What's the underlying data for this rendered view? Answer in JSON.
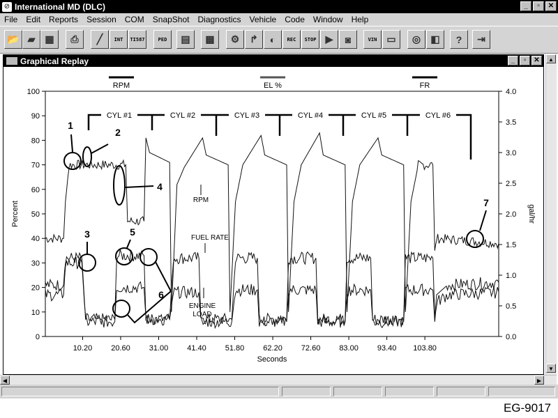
{
  "app": {
    "title": "International MD (DLC)",
    "window_buttons": [
      "_",
      "▫",
      "✕"
    ]
  },
  "menu": [
    "File",
    "Edit",
    "Reports",
    "Session",
    "COM",
    "SnapShot",
    "Diagnostics",
    "Vehicle",
    "Code",
    "Window",
    "Help"
  ],
  "toolbar": {
    "buttons": [
      {
        "name": "open-icon"
      },
      {
        "name": "save-icon"
      },
      {
        "name": "print-preview-icon"
      },
      {
        "name": "print-icon"
      },
      {
        "name": "graph-icon"
      },
      {
        "name": "int-icon",
        "text": "INT"
      },
      {
        "name": "ti587-icon",
        "text": "TI587"
      },
      {
        "name": "ped-icon",
        "text": "PED"
      },
      {
        "name": "data-icon"
      },
      {
        "name": "session-icon"
      },
      {
        "name": "engine-icon"
      },
      {
        "name": "injector-icon"
      },
      {
        "name": "gauge-icon"
      },
      {
        "name": "record-icon",
        "text": "REC"
      },
      {
        "name": "stop-icon",
        "text": "STOP"
      },
      {
        "name": "playback-icon"
      },
      {
        "name": "camera-icon"
      },
      {
        "name": "vin-icon",
        "text": "VIN"
      },
      {
        "name": "monitor-icon"
      },
      {
        "name": "sensor-icon"
      },
      {
        "name": "window-icon"
      },
      {
        "name": "help-icon",
        "text": "?"
      },
      {
        "name": "exit-icon"
      }
    ]
  },
  "child_window": {
    "title": "Graphical Replay"
  },
  "chart_data": {
    "type": "line",
    "legend": [
      "RPM",
      "EL %",
      "FR"
    ],
    "xlabel": "Seconds",
    "ylabel_left": "Percent",
    "ylabel_right": "gal/hr",
    "xlim": [
      0,
      124
    ],
    "ylim_left": [
      0,
      100
    ],
    "ylim_right": [
      0.0,
      4.0
    ],
    "x_ticks": [
      "10.20",
      "20.60",
      "31.00",
      "41.40",
      "51.80",
      "62.20",
      "72.60",
      "83.00",
      "93.40",
      "103.80"
    ],
    "x_tick_values": [
      10.2,
      20.6,
      31.0,
      41.4,
      51.8,
      62.2,
      72.6,
      83.0,
      93.4,
      103.8
    ],
    "y_ticks_left": [
      "0",
      "10",
      "20",
      "30",
      "40",
      "50",
      "60",
      "70",
      "80",
      "90",
      "100"
    ],
    "y_ticks_right": [
      "0.0",
      "0.5",
      "1.0",
      "1.5",
      "2.0",
      "2.5",
      "3.0",
      "3.5",
      "4.0"
    ],
    "series": [
      {
        "name": "RPM",
        "points": [
          [
            0,
            40
          ],
          [
            5,
            40
          ],
          [
            5.5,
            55
          ],
          [
            6.5,
            70
          ],
          [
            22,
            70
          ],
          [
            22.5,
            47
          ],
          [
            27,
            47
          ],
          [
            27.5,
            81
          ],
          [
            28.5,
            75
          ],
          [
            34,
            71
          ],
          [
            34.5,
            10
          ],
          [
            36,
            62
          ],
          [
            38,
            69
          ],
          [
            43,
            81
          ],
          [
            44,
            74
          ],
          [
            50,
            70
          ],
          [
            50.5,
            10
          ],
          [
            52,
            55
          ],
          [
            54,
            70
          ],
          [
            59,
            82
          ],
          [
            60,
            74
          ],
          [
            66,
            70
          ],
          [
            66.5,
            10
          ],
          [
            68,
            55
          ],
          [
            70,
            70
          ],
          [
            75,
            83
          ],
          [
            76,
            74
          ],
          [
            82,
            70
          ],
          [
            82.5,
            10
          ],
          [
            84,
            55
          ],
          [
            86,
            70
          ],
          [
            91,
            81
          ],
          [
            92,
            74
          ],
          [
            98,
            70
          ],
          [
            98.5,
            10
          ],
          [
            100,
            55
          ],
          [
            102,
            70
          ],
          [
            106,
            70
          ],
          [
            106.5,
            35
          ],
          [
            107,
            40
          ],
          [
            124,
            38
          ]
        ]
      },
      {
        "name": "FR",
        "points": [
          [
            0,
            21
          ],
          [
            5,
            21
          ],
          [
            5.5,
            32
          ],
          [
            10,
            32
          ],
          [
            11,
            7
          ],
          [
            19,
            7
          ],
          [
            19.5,
            33
          ],
          [
            27,
            33
          ],
          [
            27.5,
            7
          ],
          [
            34,
            7
          ],
          [
            35,
            32
          ],
          [
            42,
            32
          ],
          [
            42.5,
            7
          ],
          [
            51,
            7
          ],
          [
            52,
            32
          ],
          [
            58,
            32
          ],
          [
            58.5,
            7
          ],
          [
            66,
            7
          ],
          [
            66.5,
            32
          ],
          [
            74,
            32
          ],
          [
            74.5,
            7
          ],
          [
            82,
            7
          ],
          [
            82.5,
            32
          ],
          [
            89,
            32
          ],
          [
            89.5,
            7
          ],
          [
            98,
            7
          ],
          [
            98.5,
            32
          ],
          [
            106,
            32
          ],
          [
            106.5,
            7
          ],
          [
            107,
            17
          ],
          [
            110,
            21
          ],
          [
            124,
            22
          ]
        ]
      },
      {
        "name": "EL %",
        "points": [
          [
            0,
            17
          ],
          [
            5,
            17
          ],
          [
            5.5,
            30
          ],
          [
            10,
            30
          ],
          [
            11,
            6
          ],
          [
            19,
            6
          ],
          [
            19.5,
            20
          ],
          [
            27,
            20
          ],
          [
            27.5,
            7
          ],
          [
            34,
            7
          ],
          [
            35,
            18
          ],
          [
            42,
            18
          ],
          [
            42.5,
            6
          ],
          [
            51,
            6
          ],
          [
            52,
            19
          ],
          [
            58,
            19
          ],
          [
            58.5,
            6
          ],
          [
            66,
            6
          ],
          [
            66.5,
            19
          ],
          [
            74,
            19
          ],
          [
            74.5,
            6
          ],
          [
            82,
            6
          ],
          [
            82.5,
            19
          ],
          [
            89,
            19
          ],
          [
            89.5,
            6
          ],
          [
            98,
            6
          ],
          [
            98.5,
            19
          ],
          [
            106,
            19
          ],
          [
            106.5,
            6
          ],
          [
            107,
            14
          ],
          [
            110,
            17
          ],
          [
            124,
            18
          ]
        ]
      }
    ],
    "annotations": {
      "cylinders": [
        "CYL #1",
        "CYL #2",
        "CYL #3",
        "CYL #4",
        "CYL #5",
        "CYL #6"
      ],
      "callouts": [
        "1",
        "2",
        "3",
        "4",
        "5",
        "6",
        "7"
      ],
      "labels": [
        "RPM",
        "FUEL RATE",
        "ENGINE",
        "LOAD"
      ]
    }
  },
  "figure_label": "EG-9017"
}
